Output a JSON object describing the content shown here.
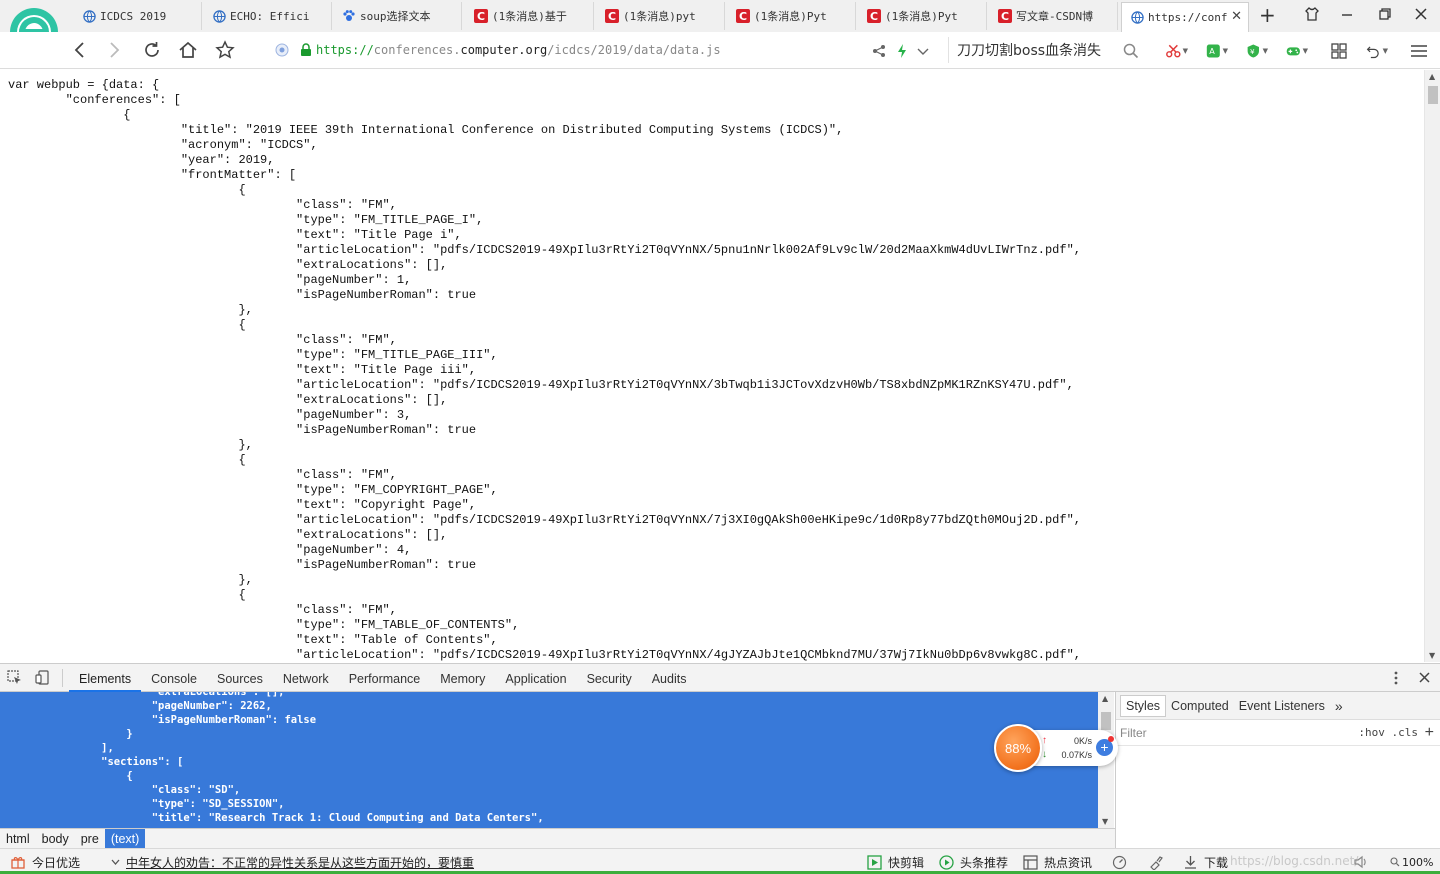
{
  "tabs": [
    {
      "label": "ICDCS 2019",
      "icon": "globe-icon"
    },
    {
      "label": "ECHO: Effici",
      "icon": "globe-icon"
    },
    {
      "label": "soup选择文本",
      "icon": "paw-icon"
    },
    {
      "label": "(1条消息)基于",
      "icon": "csdn-icon"
    },
    {
      "label": "(1条消息)pyt",
      "icon": "csdn-icon"
    },
    {
      "label": "(1条消息)Pyt",
      "icon": "csdn-icon"
    },
    {
      "label": "(1条消息)Pyt",
      "icon": "csdn-icon"
    },
    {
      "label": "写文章-CSDN博",
      "icon": "csdn-icon"
    },
    {
      "label": "https://conf",
      "icon": "globe-icon",
      "active": true
    }
  ],
  "address": {
    "scheme": "https://",
    "subdomain": "conferences.",
    "domain": "computer.org",
    "path": "/icdcs/2019/data/data.js"
  },
  "search_text": "刀刀切割boss血条消失",
  "source_text": "var webpub = {data: {\n        \"conferences\": [\n                {\n                        \"title\": \"2019 IEEE 39th International Conference on Distributed Computing Systems (ICDCS)\",\n                        \"acronym\": \"ICDCS\",\n                        \"year\": 2019,\n                        \"frontMatter\": [\n                                {\n                                        \"class\": \"FM\",\n                                        \"type\": \"FM_TITLE_PAGE_I\",\n                                        \"text\": \"Title Page i\",\n                                        \"articleLocation\": \"pdfs/ICDCS2019-49XpIlu3rRtYi2T0qVYnNX/5pnu1nNrlk002Af9Lv9clW/20d2MaaXkmW4dUvLIWrTnz.pdf\",\n                                        \"extraLocations\": [],\n                                        \"pageNumber\": 1,\n                                        \"isPageNumberRoman\": true\n                                },\n                                {\n                                        \"class\": \"FM\",\n                                        \"type\": \"FM_TITLE_PAGE_III\",\n                                        \"text\": \"Title Page iii\",\n                                        \"articleLocation\": \"pdfs/ICDCS2019-49XpIlu3rRtYi2T0qVYnNX/3bTwqb1i3JCTovXdzvH0Wb/TS8xbdNZpMK1RZnKSY47U.pdf\",\n                                        \"extraLocations\": [],\n                                        \"pageNumber\": 3,\n                                        \"isPageNumberRoman\": true\n                                },\n                                {\n                                        \"class\": \"FM\",\n                                        \"type\": \"FM_COPYRIGHT_PAGE\",\n                                        \"text\": \"Copyright Page\",\n                                        \"articleLocation\": \"pdfs/ICDCS2019-49XpIlu3rRtYi2T0qVYnNX/7j3XI0gQAkSh00eHKipe9c/1d0Rp8y77bdZQth0MOuj2D.pdf\",\n                                        \"extraLocations\": [],\n                                        \"pageNumber\": 4,\n                                        \"isPageNumberRoman\": true\n                                },\n                                {\n                                        \"class\": \"FM\",\n                                        \"type\": \"FM_TABLE_OF_CONTENTS\",\n                                        \"text\": \"Table of Contents\",\n                                        \"articleLocation\": \"pdfs/ICDCS2019-49XpIlu3rRtYi2T0qVYnNX/4gJYZAJbJte1QCMbknd7MU/37Wj7IkNu0bDp6v8vwkg8C.pdf\",",
  "devtools": {
    "tabs": [
      "Elements",
      "Console",
      "Sources",
      "Network",
      "Performance",
      "Memory",
      "Application",
      "Security",
      "Audits"
    ],
    "active_tab": "Elements",
    "elements_text": "                        \"extraLocations\": [],\n                        \"pageNumber\": 2262,\n                        \"isPageNumberRoman\": false\n                    }\n                ],\n                \"sections\": [\n                    {\n                        \"class\": \"SD\",\n                        \"type\": \"SD_SESSION\",\n                        \"title\": \"Research Track 1: Cloud Computing and Data Centers\",",
    "side_tabs": [
      "Styles",
      "Computed",
      "Event Listeners"
    ],
    "side_more": "»",
    "filter_placeholder": "Filter",
    "filter_options": ":hov  .cls",
    "breadcrumbs": [
      "html",
      "body",
      "pre",
      "(text)"
    ]
  },
  "speed_widget": {
    "percent": "88%",
    "upload": "0K/s",
    "download": "0.07K/s"
  },
  "status_bar": {
    "today": "今日优选",
    "news": "中年女人的劝告：不正常的异性关系是从这些方面开始的，要慎重",
    "quick_cut": "快剪辑",
    "headlines": "头条推荐",
    "hot_news": "热点资讯",
    "download": "下载",
    "watermark": "https://blog.csdn.net/",
    "zoom": "100%"
  },
  "colors": {
    "accent": "#1a73e8",
    "selection": "#3879d9",
    "https_green": "#1a9a2e",
    "csdn_red": "#d8202a",
    "widget_orange": "#f2711c"
  }
}
